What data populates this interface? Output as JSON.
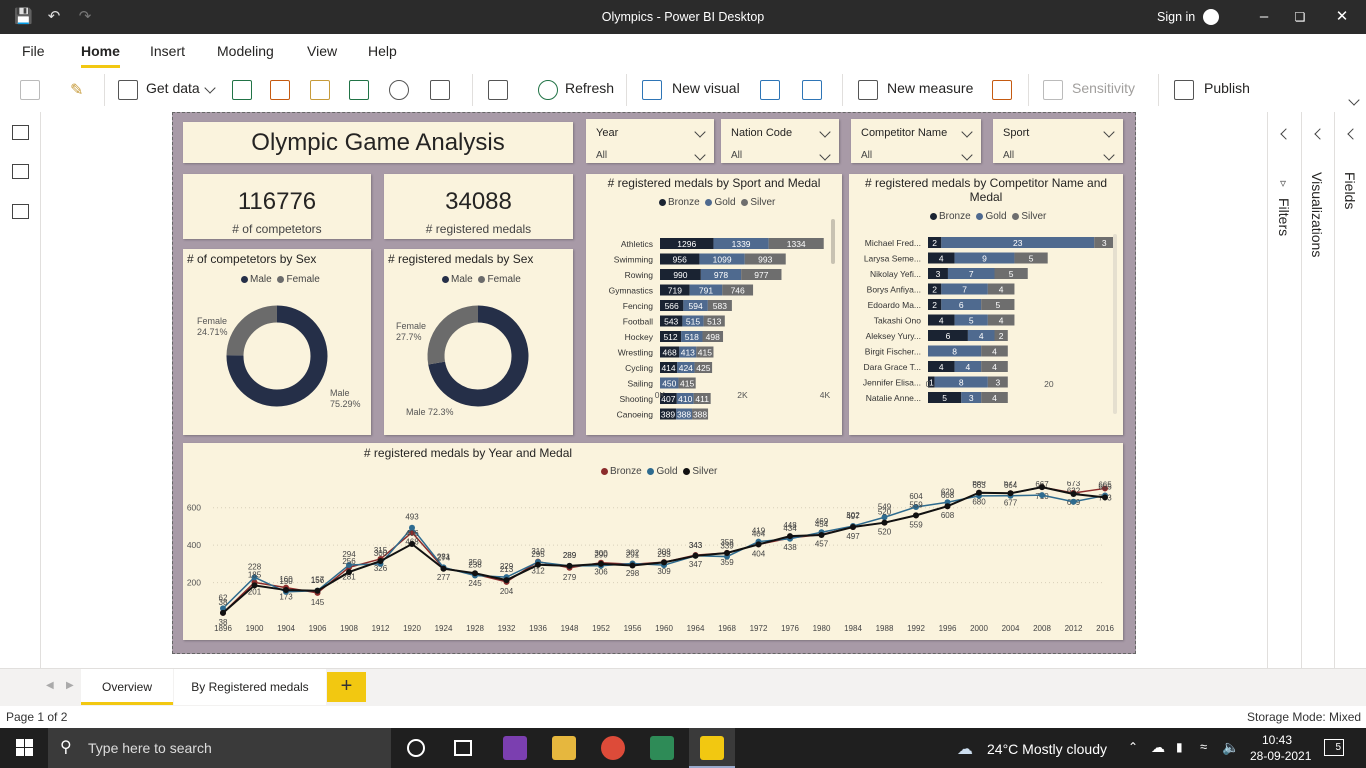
{
  "window": {
    "title": "Olympics - Power BI Desktop",
    "sign_in": "Sign in"
  },
  "menu": [
    "File",
    "Home",
    "Insert",
    "Modeling",
    "View",
    "Help"
  ],
  "ribbon": {
    "get_data": "Get data",
    "refresh": "Refresh",
    "new_visual": "New visual",
    "new_measure": "New measure",
    "sensitivity": "Sensitivity",
    "publish": "Publish"
  },
  "report": {
    "title": "Olympic Game Analysis",
    "slicers": [
      {
        "label": "Year",
        "value": "All"
      },
      {
        "label": "Nation Code",
        "value": "All"
      },
      {
        "label": "Competitor Name",
        "value": "All"
      },
      {
        "label": "Sport",
        "value": "All"
      }
    ],
    "kpis": [
      {
        "value": "116776",
        "label": "# of competetors"
      },
      {
        "value": "34088",
        "label": "# registered medals"
      }
    ],
    "legend_mf": [
      "Male",
      "Female"
    ],
    "legend_medal": [
      "Bronze",
      "Gold",
      "Silver"
    ],
    "colors": {
      "navy": "#252f48",
      "grey": "#6b6b6b",
      "bronze": "#1a2332",
      "gold": "#4f6a8f",
      "silver": "#6e6e6e",
      "line_bronze": "#8b2b2b",
      "line_gold": "#2e6b8f",
      "line_silver": "#111111",
      "card": "#faf3dd"
    }
  },
  "chart_data": [
    {
      "type": "pie",
      "title": "# of competetors by Sex",
      "labels": [
        "Male",
        "Female"
      ],
      "values": [
        75.29,
        24.71
      ],
      "value_labels": [
        "Male\n75.29%",
        "Female\n24.71%"
      ]
    },
    {
      "type": "pie",
      "title": "# registered medals by Sex",
      "labels": [
        "Male",
        "Female"
      ],
      "values": [
        72.3,
        27.7
      ],
      "value_labels": [
        "Male 72.3%",
        "Female\n27.7%"
      ]
    },
    {
      "type": "bar",
      "title": "# registered medals by Sport and Medal",
      "orientation": "horizontal",
      "stacked": true,
      "categories": [
        "Athletics",
        "Swimming",
        "Rowing",
        "Gymnastics",
        "Fencing",
        "Football",
        "Hockey",
        "Wrestling",
        "Cycling",
        "Sailing",
        "Shooting",
        "Canoeing"
      ],
      "series": [
        {
          "name": "Bronze",
          "values": [
            1296,
            956,
            990,
            719,
            566,
            543,
            512,
            468,
            414,
            null,
            407,
            389
          ]
        },
        {
          "name": "Gold",
          "values": [
            1339,
            1099,
            978,
            791,
            594,
            515,
            518,
            413,
            424,
            450,
            410,
            388
          ]
        },
        {
          "name": "Silver",
          "values": [
            1334,
            993,
            977,
            746,
            583,
            513,
            498,
            415,
            425,
            415,
            411,
            388
          ]
        }
      ],
      "xticks": [
        "0K",
        "2K",
        "4K"
      ],
      "xlim": [
        0,
        4000
      ]
    },
    {
      "type": "bar",
      "title": "# registered medals by Competitor Name and Medal",
      "orientation": "horizontal",
      "stacked": true,
      "categories": [
        "Michael Fred...",
        "Larysa Seme...",
        "Nikolay Yefi...",
        "Borys Anfiya...",
        "Edoardo Ma...",
        "Takashi Ono",
        "Aleksey Yury...",
        "Birgit Fischer...",
        "Dara Grace T...",
        "Jennifer Elisa...",
        "Natalie Anne..."
      ],
      "series": [
        {
          "name": "Bronze",
          "values": [
            2,
            4,
            3,
            2,
            2,
            4,
            6,
            null,
            4,
            1,
            5
          ]
        },
        {
          "name": "Gold",
          "values": [
            23,
            9,
            7,
            7,
            6,
            5,
            4,
            8,
            4,
            8,
            3
          ]
        },
        {
          "name": "Silver",
          "values": [
            3,
            5,
            5,
            4,
            5,
            4,
            2,
            4,
            4,
            3,
            4
          ]
        }
      ],
      "xticks": [
        "0",
        "20"
      ],
      "xlim": [
        0,
        30
      ]
    },
    {
      "type": "line",
      "title": "# registered medals by Year and Medal",
      "x": [
        "1896",
        "1900",
        "1904",
        "1906",
        "1908",
        "1912",
        "1920",
        "1924",
        "1928",
        "1932",
        "1936",
        "1948",
        "1952",
        "1956",
        "1960",
        "1964",
        "1968",
        "1972",
        "1976",
        "1980",
        "1984",
        "1988",
        "1992",
        "1996",
        "2000",
        "2004",
        "2008",
        "2012",
        "2016"
      ],
      "series": [
        {
          "name": "Bronze",
          "values": [
            38,
            201,
            173,
            145,
            281,
            326,
            468,
            277,
            245,
            204,
            312,
            279,
            306,
            298,
            309,
            347,
            359,
            404,
            438,
            457,
            497,
            520,
            559,
            608,
            680,
            677,
            710,
            679,
            703
          ]
        },
        {
          "name": "Gold",
          "values": [
            62,
            228,
            150,
            157,
            294,
            300,
            493,
            281,
            238,
            229,
            310,
            289,
            290,
            302,
            293,
            343,
            339,
            419,
            434,
            469,
            502,
            549,
            604,
            629,
            663,
            664,
            667,
            632,
            665
          ]
        },
        {
          "name": "Silver",
          "values": [
            38,
            185,
            160,
            156,
            256,
            315,
            406,
            274,
            250,
            213,
            295,
            289,
            300,
            291,
            308,
            343,
            358,
            404,
            448,
            454,
            497,
            520,
            559,
            608,
            680,
            677,
            710,
            673,
            655
          ]
        }
      ],
      "yticks": [
        "200",
        "400",
        "600"
      ],
      "ylim": [
        0,
        700
      ]
    }
  ],
  "panes": {
    "filters": "Filters",
    "visualizations": "Visualizations",
    "fields": "Fields"
  },
  "tabs": [
    "Overview",
    "By Registered medals"
  ],
  "status": {
    "page": "Page 1 of 2",
    "storage": "Storage Mode: Mixed"
  },
  "taskbar": {
    "search": "Type here to search",
    "weather": "24°C  Mostly cloudy",
    "time": "10:43",
    "date": "28-09-2021",
    "notifications": "5"
  }
}
